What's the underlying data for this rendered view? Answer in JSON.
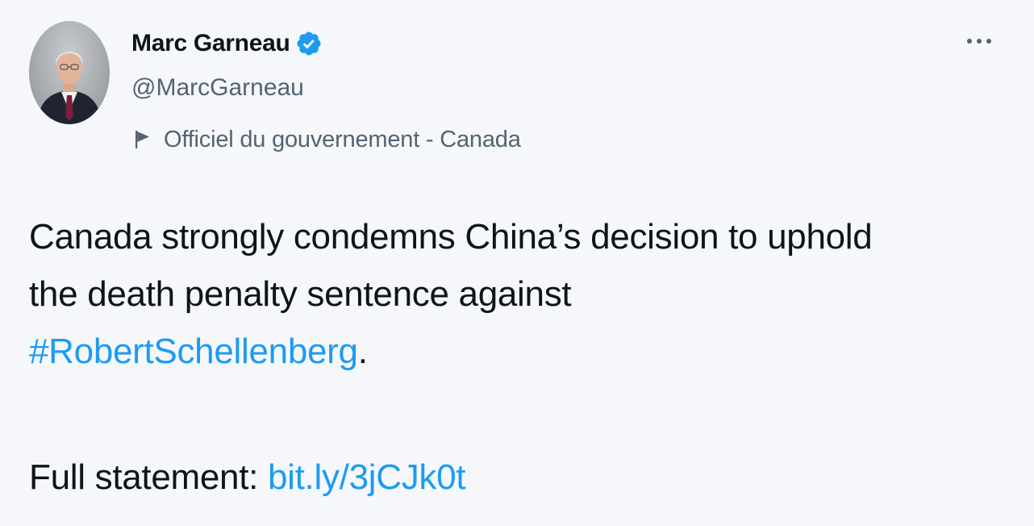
{
  "author": {
    "display_name": "Marc Garneau",
    "handle": "@MarcGarneau",
    "verified_icon": "verified-badge-icon",
    "label_icon": "flag-icon",
    "label": "Officiel du gouvernement - Canada"
  },
  "menu": {
    "icon": "more-horizontal-icon"
  },
  "tweet": {
    "line1": "Canada strongly condemns China’s decision to uphold",
    "line2": "the death penalty sentence against",
    "hashtag": "#RobertSchellenberg",
    "after_hashtag": ".",
    "statement_prefix": "Full statement: ",
    "link_text": "bit.ly/3jCJk0t"
  },
  "colors": {
    "link": "#1d9bf0",
    "verified": "#1d9bf0",
    "secondary_text": "#536471",
    "primary_text": "#0f1419",
    "background": "#f5f7fa"
  }
}
